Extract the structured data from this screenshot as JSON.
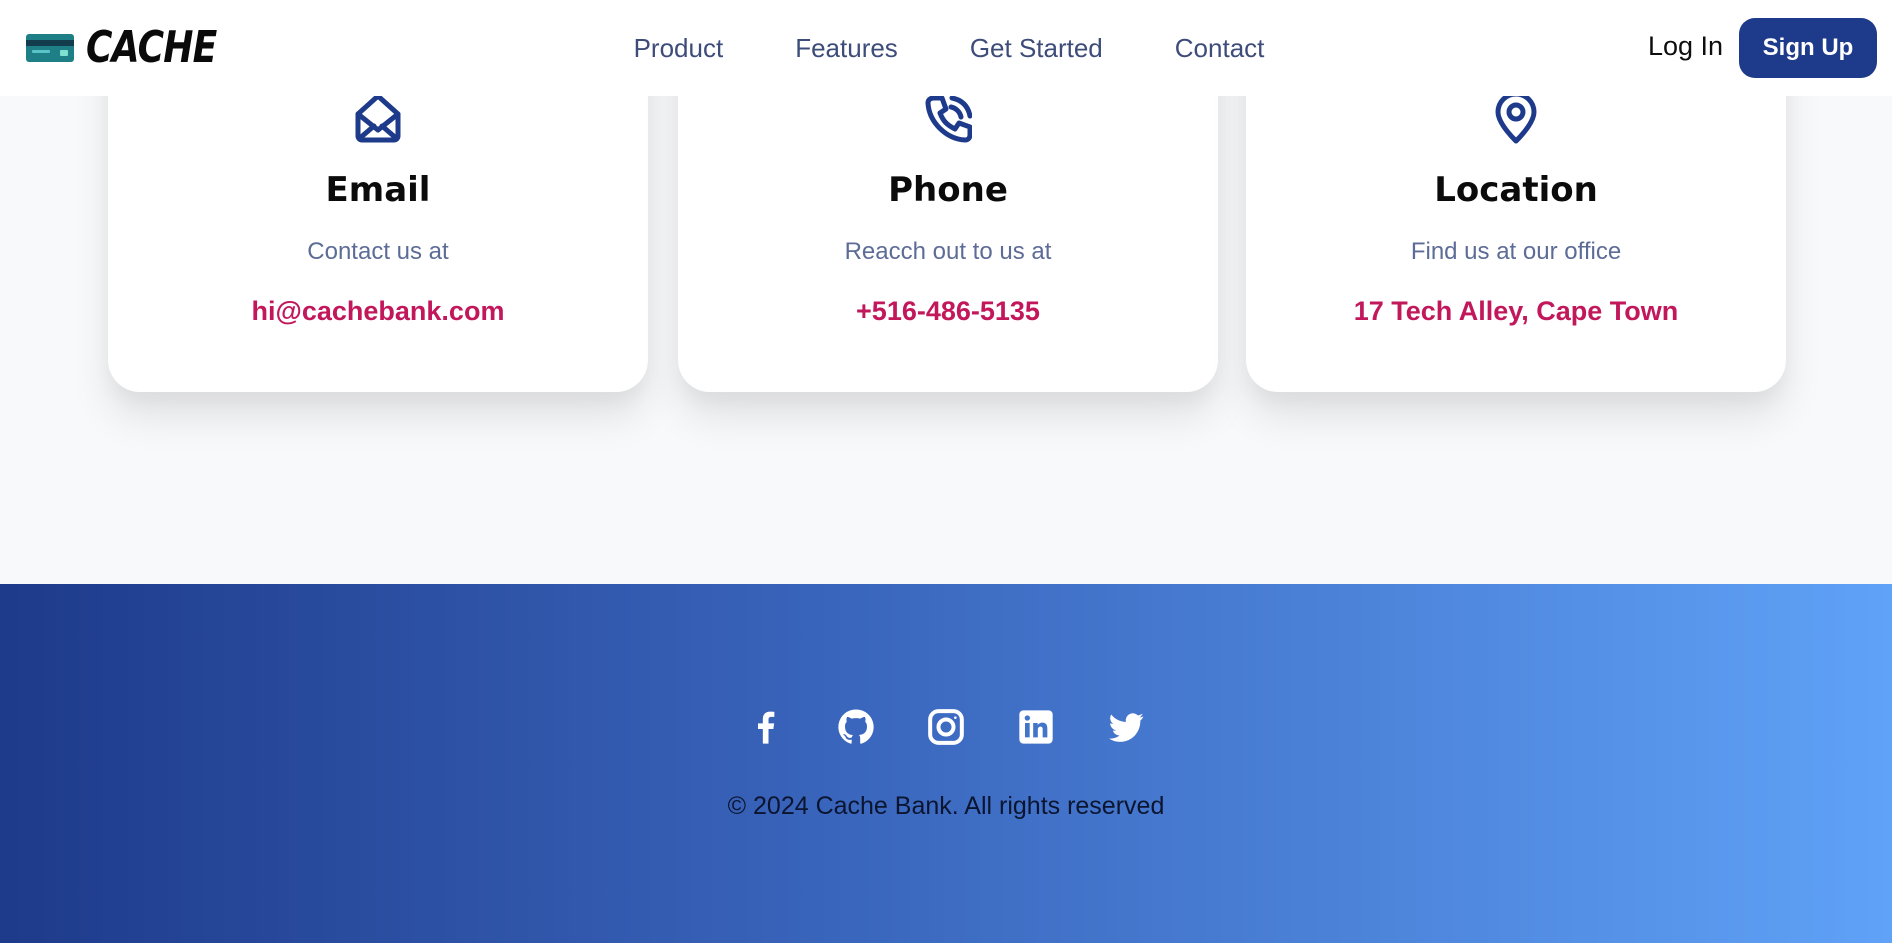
{
  "header": {
    "brand": "CACHE",
    "nav": [
      "Product",
      "Features",
      "Get Started",
      "Contact"
    ],
    "login": "Log In",
    "signup": "Sign Up"
  },
  "contact": {
    "cards": [
      {
        "icon": "envelope-open-icon",
        "title": "Email",
        "subtitle": "Contact us at",
        "value": "hi@cachebank.com"
      },
      {
        "icon": "phone-call-icon",
        "title": "Phone",
        "subtitle": "Reacch out to us at",
        "value": "+516-486-5135"
      },
      {
        "icon": "map-pin-icon",
        "title": "Location",
        "subtitle": "Find us at our office",
        "value": "17 Tech Alley, Cape Town"
      }
    ]
  },
  "footer": {
    "socials": [
      "facebook-icon",
      "github-icon",
      "instagram-icon",
      "linkedin-icon",
      "twitter-icon"
    ],
    "copyright": "© 2024 Cache Bank. All rights reserved"
  },
  "colors": {
    "brand_blue": "#1e3a8a",
    "accent_pink": "#c2185b",
    "nav_text": "#3e4c7a",
    "footer_gradient_start": "#1e3a8a",
    "footer_gradient_end": "#5fa2f7"
  }
}
